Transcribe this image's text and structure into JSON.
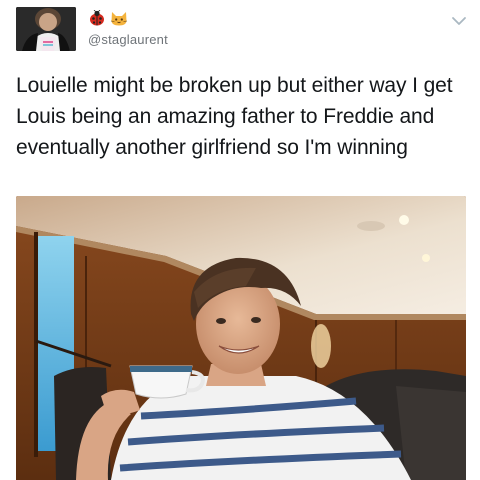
{
  "tweet": {
    "emoji": [
      "lady-beetle-icon",
      "cat-face-icon"
    ],
    "handle": "@staglaurent",
    "text": "Louielle might be broken up but either way I get Louis being an amazing father to Freddie and eventually another girlfriend so I'm winning",
    "menu_icon": "chevron-down-icon",
    "media_description_icon": "photo"
  },
  "colors": {
    "text": "#14171a",
    "secondary_text": "#6e7378",
    "chevron": "#aab8c2"
  }
}
